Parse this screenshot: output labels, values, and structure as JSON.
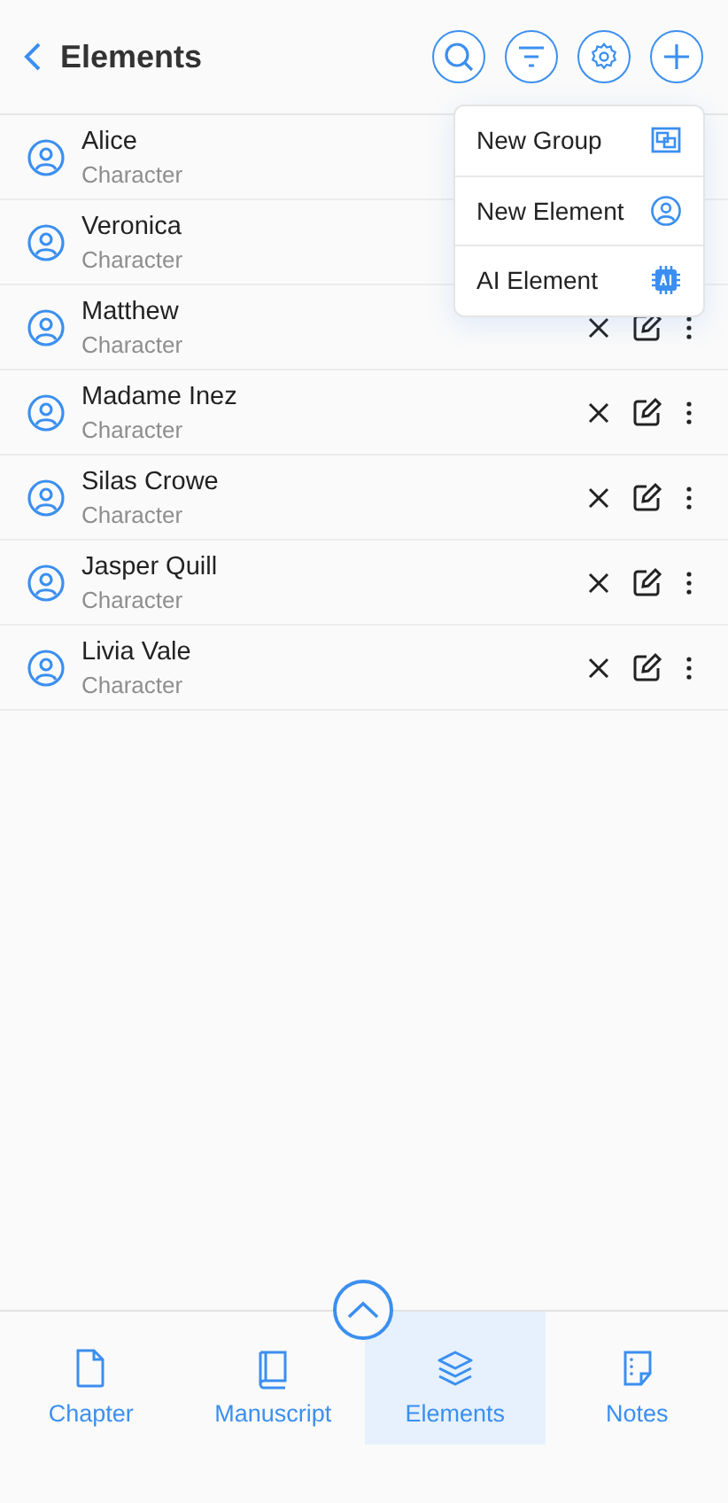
{
  "header": {
    "title": "Elements"
  },
  "rows": [
    {
      "name": "Alice",
      "type": "Character"
    },
    {
      "name": "Veronica",
      "type": "Character"
    },
    {
      "name": "Matthew",
      "type": "Character"
    },
    {
      "name": "Madame Inez",
      "type": "Character"
    },
    {
      "name": "Silas Crowe",
      "type": "Character"
    },
    {
      "name": "Jasper Quill",
      "type": "Character"
    },
    {
      "name": "Livia Vale",
      "type": "Character"
    }
  ],
  "menu": {
    "items": [
      {
        "label": "New Group",
        "kind": "group"
      },
      {
        "label": "New Element",
        "kind": "element"
      },
      {
        "label": "AI Element",
        "kind": "ai"
      }
    ]
  },
  "tabs": [
    {
      "label": "Chapter",
      "kind": "chapter",
      "selected": false
    },
    {
      "label": "Manuscript",
      "kind": "manuscript",
      "selected": false
    },
    {
      "label": "Elements",
      "kind": "elements",
      "selected": true
    },
    {
      "label": "Notes",
      "kind": "notes",
      "selected": false
    }
  ]
}
